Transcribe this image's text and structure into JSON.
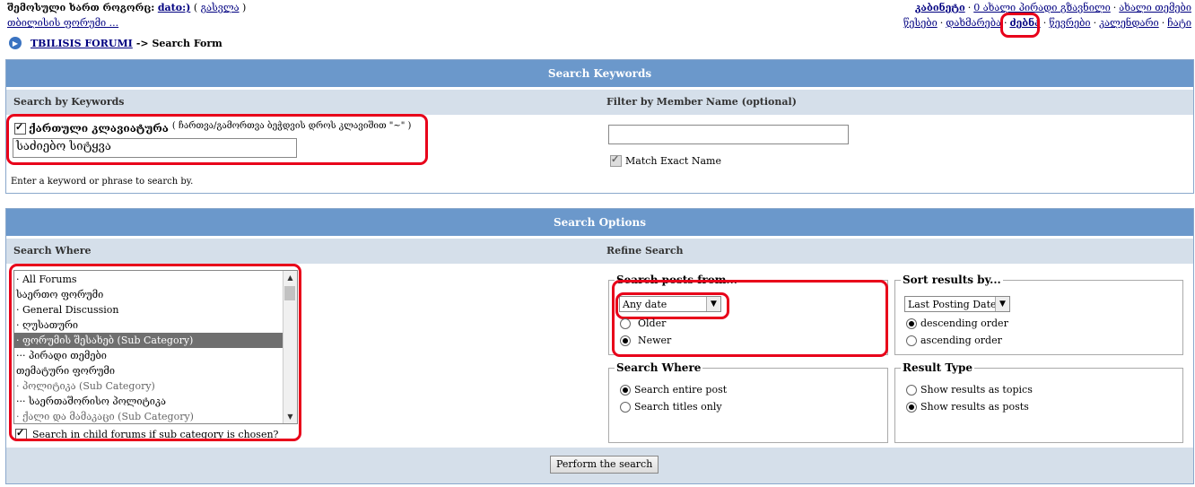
{
  "top": {
    "logged_in_as": "შემოსული ხართ როგორც:",
    "username": "dato:)",
    "logout": "გასვლა",
    "forum_link": "თბილისის ფორუმი ...",
    "right_row1": [
      "კაბინეტი",
      "0 ახალი პირადი გზავნილი",
      "ახალი თემები"
    ],
    "right_row2": [
      "წესები",
      "დახმარება",
      "ძებნა",
      "წევრები",
      "კალენდარი",
      "ჩატი"
    ]
  },
  "breadcrumb": {
    "forum": "TBILISIS FORUMI",
    "current": "-> Search Form"
  },
  "keywords_panel": {
    "title": "Search Keywords",
    "left_head": "Search by Keywords",
    "right_head": "Filter by Member Name (optional)",
    "georgian_kb_label": "ქართული კლავიატურა",
    "georgian_kb_hint": "( ჩართვა/გამორთვა ბეჭდვის დროს კლავიშით \"~\" )",
    "keyword_value": "საძიებო სიტყვა",
    "member_value": "",
    "match_exact": "Match Exact Name",
    "hint": "Enter a keyword or phrase to search by."
  },
  "options_panel": {
    "title": "Search Options",
    "left_head": "Search Where",
    "right_head": "Refine Search",
    "forums": [
      {
        "label": "· All Forums",
        "style": ""
      },
      {
        "label": "საერთო ფორუმი",
        "style": ""
      },
      {
        "label": "· General Discussion",
        "style": ""
      },
      {
        "label": "· ღუსათური",
        "style": ""
      },
      {
        "label": "· ფორუმის შესახებ (Sub Category)",
        "style": "sel"
      },
      {
        "label": "··· პირადი თემები",
        "style": ""
      },
      {
        "label": "თემატური ფორუმი",
        "style": ""
      },
      {
        "label": "· პოლიტიკა (Sub Category)",
        "style": "grey"
      },
      {
        "label": "··· საერთაშორისო პოლიტიკა",
        "style": ""
      },
      {
        "label": "· ქალი და მამაკაცი (Sub Category)",
        "style": "grey"
      }
    ],
    "child_forums": "Search in child forums if sub category is chosen?",
    "posts_from_title": "Search posts from...",
    "date_value": "Any date",
    "older": "Older",
    "newer": "Newer",
    "sort_title": "Sort results by...",
    "sort_value": "Last Posting Date",
    "desc": "descending order",
    "asc": "ascending order",
    "where_title": "Search Where",
    "entire_post": "Search entire post",
    "titles_only": "Search titles only",
    "result_title": "Result Type",
    "as_topics": "Show results as topics",
    "as_posts": "Show results as posts",
    "submit": "Perform the search"
  },
  "colors": {
    "header_blue": "#6b98cb",
    "subhead_grey": "#d5dfea",
    "highlight_red": "#e8001a",
    "link": "#000080"
  }
}
